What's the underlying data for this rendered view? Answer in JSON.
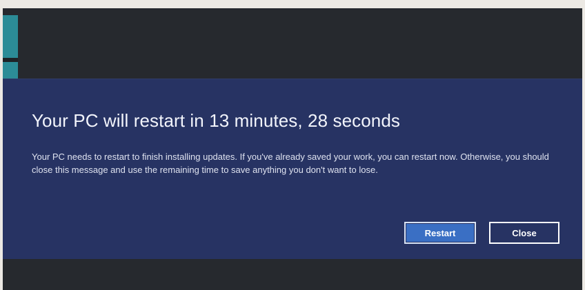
{
  "dialog": {
    "title": "Your PC will restart in 13 minutes, 28 seconds",
    "message": "Your PC needs to restart to finish installing updates. If you've already saved your work, you can restart now. Otherwise, you should close this message and use the remaining time to save anything you don't want to lose.",
    "restart_label": "Restart",
    "close_label": "Close"
  },
  "colors": {
    "dialog_background": "#273363",
    "desktop_background": "#26292e",
    "accent": "#3a6fc4",
    "tile": "#2c8c97"
  }
}
